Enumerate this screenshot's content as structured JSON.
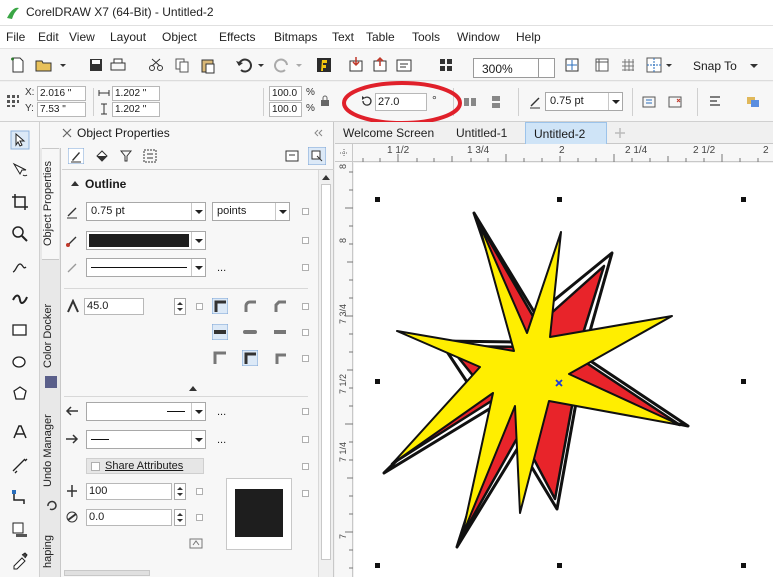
{
  "window": {
    "title": "CorelDRAW X7 (64-Bit) - Untitled-2"
  },
  "menu": [
    "File",
    "Edit",
    "View",
    "Layout",
    "Object",
    "Effects",
    "Bitmaps",
    "Text",
    "Table",
    "Tools",
    "Window",
    "Help"
  ],
  "toolbar": {
    "zoom": "300%",
    "snap_label": "Snap To"
  },
  "propbar": {
    "x_label": "X:",
    "x": "2.016 \"",
    "y_label": "Y:",
    "y": "7.53 \"",
    "w": "1.202 \"",
    "h": "1.202 \"",
    "scale_x": "100.0",
    "scale_y": "100.0",
    "pct": "%",
    "rotation": "27.0",
    "degree": "°",
    "outline_width": "0.75 pt"
  },
  "docker": {
    "title": "Object Properties",
    "section": "Outline",
    "width_value": "0.75 pt",
    "units": "points",
    "ellipsis": "...",
    "miter_limit": "45.0",
    "share_attributes": "Share Attributes",
    "stretch": "100",
    "angle": "0.0",
    "vertical_tabs": [
      "Object Properties",
      "Color Docker",
      "Undo Manager",
      "haping"
    ]
  },
  "doc_tabs": [
    "Welcome Screen",
    "Untitled-1",
    "Untitled-2"
  ],
  "active_doc_tab": "Untitled-2",
  "ruler": {
    "h_labels": [
      "1 1/2",
      "1 3/4",
      "2",
      "2 1/4",
      "2 1/2",
      "2"
    ],
    "v_labels": [
      "8",
      "8",
      "7 3/4",
      "7 1/2",
      "7 1/4",
      "7"
    ]
  },
  "colors": {
    "star_inner": "#ffee00",
    "star_outer": "#e8242a",
    "outline": "#111111",
    "annotation": "#e0202a",
    "active_tab": "#cfe4f7"
  }
}
